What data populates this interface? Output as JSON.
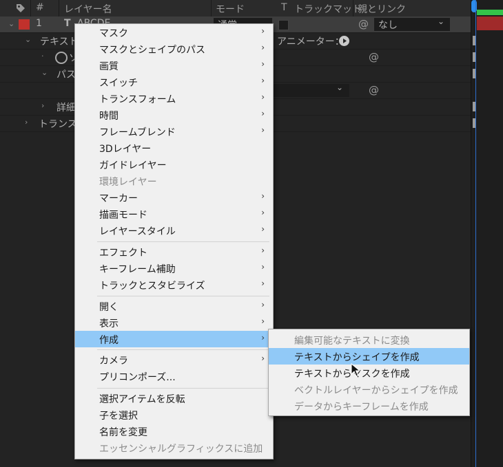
{
  "header": {
    "col_layer_name": "レイヤー名",
    "col_num": "#",
    "col_mode": "モード",
    "col_t": "T",
    "col_trackmatte": "トラックマット",
    "col_parent": "親とリンク"
  },
  "layer_row": {
    "number": "1",
    "name": "ABCDE",
    "mode_value": "通常",
    "parent_value": "なし"
  },
  "tree": {
    "text_label": "テキスト",
    "animator_label": "アニメーター：",
    "source_label": "ソ",
    "path_label": "パス",
    "detail_label": "詳細",
    "transform_label": "トランス"
  },
  "menu": {
    "items": [
      {
        "label": "マスク",
        "submenu": true,
        "enabled": true
      },
      {
        "label": "マスクとシェイプのパス",
        "submenu": true,
        "enabled": true
      },
      {
        "label": "画質",
        "submenu": true,
        "enabled": true
      },
      {
        "label": "スイッチ",
        "submenu": true,
        "enabled": true
      },
      {
        "label": "トランスフォーム",
        "submenu": true,
        "enabled": true
      },
      {
        "label": "時間",
        "submenu": true,
        "enabled": true
      },
      {
        "label": "フレームブレンド",
        "submenu": true,
        "enabled": true
      },
      {
        "label": "3Dレイヤー",
        "submenu": false,
        "enabled": true
      },
      {
        "label": "ガイドレイヤー",
        "submenu": false,
        "enabled": true
      },
      {
        "label": "環境レイヤー",
        "submenu": false,
        "enabled": false
      },
      {
        "label": "マーカー",
        "submenu": true,
        "enabled": true
      },
      {
        "label": "描画モード",
        "submenu": true,
        "enabled": true
      },
      {
        "label": "レイヤースタイル",
        "submenu": true,
        "enabled": true
      },
      {
        "label": "エフェクト",
        "submenu": true,
        "enabled": true
      },
      {
        "label": "キーフレーム補助",
        "submenu": true,
        "enabled": true
      },
      {
        "label": "トラックとスタビライズ",
        "submenu": true,
        "enabled": true
      },
      {
        "label": "開く",
        "submenu": true,
        "enabled": true
      },
      {
        "label": "表示",
        "submenu": true,
        "enabled": true
      },
      {
        "label": "作成",
        "submenu": true,
        "enabled": true,
        "highlighted": true
      },
      {
        "label": "カメラ",
        "submenu": true,
        "enabled": true
      },
      {
        "label": "プリコンポーズ...",
        "submenu": false,
        "enabled": true
      },
      {
        "label": "選択アイテムを反転",
        "submenu": false,
        "enabled": true
      },
      {
        "label": "子を選択",
        "submenu": false,
        "enabled": true
      },
      {
        "label": "名前を変更",
        "submenu": false,
        "enabled": true
      },
      {
        "label": "エッセンシャルグラフィックスに追加",
        "submenu": false,
        "enabled": false
      }
    ]
  },
  "submenu_create": {
    "items": [
      {
        "label": "編集可能なテキストに変換",
        "enabled": false
      },
      {
        "label": "テキストからシェイプを作成",
        "enabled": true,
        "highlighted": true
      },
      {
        "label": "テキストからマスクを作成",
        "enabled": true
      },
      {
        "label": "ベクトルレイヤーからシェイプを作成",
        "enabled": false
      },
      {
        "label": "データからキーフレームを作成",
        "enabled": false
      }
    ]
  },
  "icons": {
    "submenu_arrow": "›",
    "expand_arrow": "›",
    "collapse_arrow": "⌄",
    "spiral": "@",
    "play": "▶",
    "stopwatch": "◯",
    "dropdown": "⌄",
    "tag": "tag-icon"
  },
  "colors": {
    "label_red": "#c1312c",
    "highlight": "#91c9f7",
    "timeline_green": "#34c24a",
    "timeline_blue": "#2d8ceb"
  }
}
